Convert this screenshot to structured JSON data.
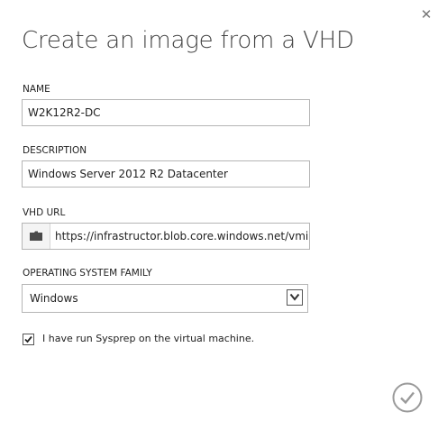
{
  "dialog": {
    "title": "Create an image from a VHD",
    "close_icon": "close-icon",
    "confirm_icon": "checkmark-circle-icon"
  },
  "fields": {
    "name": {
      "label": "NAME",
      "value": "W2K12R2-DC"
    },
    "description": {
      "label": "DESCRIPTION",
      "value": "Windows Server 2012 R2 Datacenter"
    },
    "vhd_url": {
      "label": "VHD URL",
      "value": "https://infrastructor.blob.core.windows.net/vmim",
      "browse_icon": "folder-icon"
    },
    "os_family": {
      "label": "OPERATING SYSTEM FAMILY",
      "selected": "Windows"
    }
  },
  "sysprep": {
    "label": "I have run Sysprep on the virtual machine.",
    "checked": true
  },
  "colors": {
    "border": "#b5b5b5",
    "text": "#222222",
    "title": "#444444",
    "confirm": "#9a9a9a"
  }
}
